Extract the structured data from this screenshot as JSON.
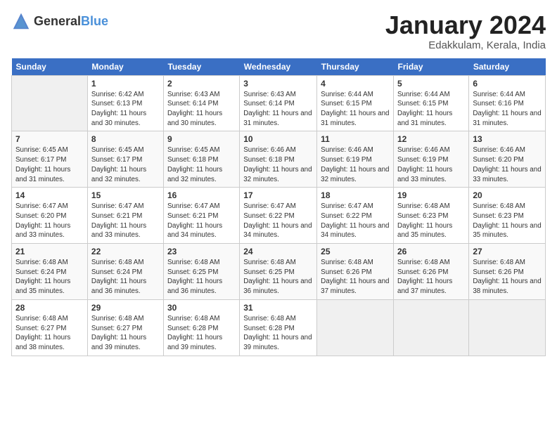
{
  "header": {
    "logo_general": "General",
    "logo_blue": "Blue",
    "month_title": "January 2024",
    "location": "Edakkulam, Kerala, India"
  },
  "calendar": {
    "days_of_week": [
      "Sunday",
      "Monday",
      "Tuesday",
      "Wednesday",
      "Thursday",
      "Friday",
      "Saturday"
    ],
    "weeks": [
      [
        {
          "day": "",
          "sunrise": "",
          "sunset": "",
          "daylight": "",
          "empty": true
        },
        {
          "day": "1",
          "sunrise": "Sunrise: 6:42 AM",
          "sunset": "Sunset: 6:13 PM",
          "daylight": "Daylight: 11 hours and 30 minutes."
        },
        {
          "day": "2",
          "sunrise": "Sunrise: 6:43 AM",
          "sunset": "Sunset: 6:14 PM",
          "daylight": "Daylight: 11 hours and 30 minutes."
        },
        {
          "day": "3",
          "sunrise": "Sunrise: 6:43 AM",
          "sunset": "Sunset: 6:14 PM",
          "daylight": "Daylight: 11 hours and 31 minutes."
        },
        {
          "day": "4",
          "sunrise": "Sunrise: 6:44 AM",
          "sunset": "Sunset: 6:15 PM",
          "daylight": "Daylight: 11 hours and 31 minutes."
        },
        {
          "day": "5",
          "sunrise": "Sunrise: 6:44 AM",
          "sunset": "Sunset: 6:15 PM",
          "daylight": "Daylight: 11 hours and 31 minutes."
        },
        {
          "day": "6",
          "sunrise": "Sunrise: 6:44 AM",
          "sunset": "Sunset: 6:16 PM",
          "daylight": "Daylight: 11 hours and 31 minutes."
        }
      ],
      [
        {
          "day": "7",
          "sunrise": "Sunrise: 6:45 AM",
          "sunset": "Sunset: 6:17 PM",
          "daylight": "Daylight: 11 hours and 31 minutes."
        },
        {
          "day": "8",
          "sunrise": "Sunrise: 6:45 AM",
          "sunset": "Sunset: 6:17 PM",
          "daylight": "Daylight: 11 hours and 32 minutes."
        },
        {
          "day": "9",
          "sunrise": "Sunrise: 6:45 AM",
          "sunset": "Sunset: 6:18 PM",
          "daylight": "Daylight: 11 hours and 32 minutes."
        },
        {
          "day": "10",
          "sunrise": "Sunrise: 6:46 AM",
          "sunset": "Sunset: 6:18 PM",
          "daylight": "Daylight: 11 hours and 32 minutes."
        },
        {
          "day": "11",
          "sunrise": "Sunrise: 6:46 AM",
          "sunset": "Sunset: 6:19 PM",
          "daylight": "Daylight: 11 hours and 32 minutes."
        },
        {
          "day": "12",
          "sunrise": "Sunrise: 6:46 AM",
          "sunset": "Sunset: 6:19 PM",
          "daylight": "Daylight: 11 hours and 33 minutes."
        },
        {
          "day": "13",
          "sunrise": "Sunrise: 6:46 AM",
          "sunset": "Sunset: 6:20 PM",
          "daylight": "Daylight: 11 hours and 33 minutes."
        }
      ],
      [
        {
          "day": "14",
          "sunrise": "Sunrise: 6:47 AM",
          "sunset": "Sunset: 6:20 PM",
          "daylight": "Daylight: 11 hours and 33 minutes."
        },
        {
          "day": "15",
          "sunrise": "Sunrise: 6:47 AM",
          "sunset": "Sunset: 6:21 PM",
          "daylight": "Daylight: 11 hours and 33 minutes."
        },
        {
          "day": "16",
          "sunrise": "Sunrise: 6:47 AM",
          "sunset": "Sunset: 6:21 PM",
          "daylight": "Daylight: 11 hours and 34 minutes."
        },
        {
          "day": "17",
          "sunrise": "Sunrise: 6:47 AM",
          "sunset": "Sunset: 6:22 PM",
          "daylight": "Daylight: 11 hours and 34 minutes."
        },
        {
          "day": "18",
          "sunrise": "Sunrise: 6:47 AM",
          "sunset": "Sunset: 6:22 PM",
          "daylight": "Daylight: 11 hours and 34 minutes."
        },
        {
          "day": "19",
          "sunrise": "Sunrise: 6:48 AM",
          "sunset": "Sunset: 6:23 PM",
          "daylight": "Daylight: 11 hours and 35 minutes."
        },
        {
          "day": "20",
          "sunrise": "Sunrise: 6:48 AM",
          "sunset": "Sunset: 6:23 PM",
          "daylight": "Daylight: 11 hours and 35 minutes."
        }
      ],
      [
        {
          "day": "21",
          "sunrise": "Sunrise: 6:48 AM",
          "sunset": "Sunset: 6:24 PM",
          "daylight": "Daylight: 11 hours and 35 minutes."
        },
        {
          "day": "22",
          "sunrise": "Sunrise: 6:48 AM",
          "sunset": "Sunset: 6:24 PM",
          "daylight": "Daylight: 11 hours and 36 minutes."
        },
        {
          "day": "23",
          "sunrise": "Sunrise: 6:48 AM",
          "sunset": "Sunset: 6:25 PM",
          "daylight": "Daylight: 11 hours and 36 minutes."
        },
        {
          "day": "24",
          "sunrise": "Sunrise: 6:48 AM",
          "sunset": "Sunset: 6:25 PM",
          "daylight": "Daylight: 11 hours and 36 minutes."
        },
        {
          "day": "25",
          "sunrise": "Sunrise: 6:48 AM",
          "sunset": "Sunset: 6:26 PM",
          "daylight": "Daylight: 11 hours and 37 minutes."
        },
        {
          "day": "26",
          "sunrise": "Sunrise: 6:48 AM",
          "sunset": "Sunset: 6:26 PM",
          "daylight": "Daylight: 11 hours and 37 minutes."
        },
        {
          "day": "27",
          "sunrise": "Sunrise: 6:48 AM",
          "sunset": "Sunset: 6:26 PM",
          "daylight": "Daylight: 11 hours and 38 minutes."
        }
      ],
      [
        {
          "day": "28",
          "sunrise": "Sunrise: 6:48 AM",
          "sunset": "Sunset: 6:27 PM",
          "daylight": "Daylight: 11 hours and 38 minutes."
        },
        {
          "day": "29",
          "sunrise": "Sunrise: 6:48 AM",
          "sunset": "Sunset: 6:27 PM",
          "daylight": "Daylight: 11 hours and 39 minutes."
        },
        {
          "day": "30",
          "sunrise": "Sunrise: 6:48 AM",
          "sunset": "Sunset: 6:28 PM",
          "daylight": "Daylight: 11 hours and 39 minutes."
        },
        {
          "day": "31",
          "sunrise": "Sunrise: 6:48 AM",
          "sunset": "Sunset: 6:28 PM",
          "daylight": "Daylight: 11 hours and 39 minutes."
        },
        {
          "day": "",
          "sunrise": "",
          "sunset": "",
          "daylight": "",
          "empty": true
        },
        {
          "day": "",
          "sunrise": "",
          "sunset": "",
          "daylight": "",
          "empty": true
        },
        {
          "day": "",
          "sunrise": "",
          "sunset": "",
          "daylight": "",
          "empty": true
        }
      ]
    ]
  }
}
